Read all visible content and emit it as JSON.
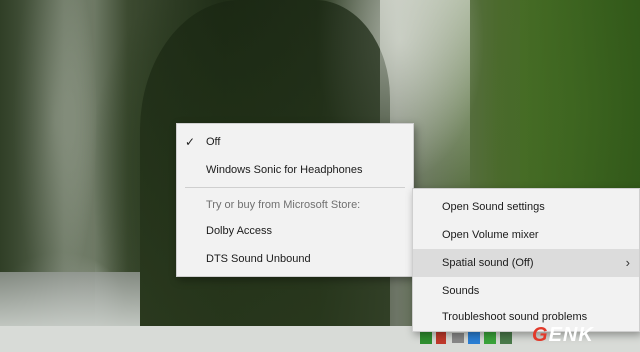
{
  "desktop": {
    "wallpaper": "mossy canyon"
  },
  "spatial_menu": {
    "items": [
      {
        "label": "Off",
        "checked": true
      },
      {
        "label": "Windows Sonic for Headphones"
      },
      {
        "label": "Try or buy from Microsoft Store:"
      },
      {
        "label": "Dolby Access"
      },
      {
        "label": "DTS Sound Unbound"
      }
    ]
  },
  "sound_menu": {
    "items": [
      {
        "label": "Open Sound settings"
      },
      {
        "label": "Open Volume mixer"
      },
      {
        "label": "Spatial sound (Off)"
      },
      {
        "label": "Sounds"
      },
      {
        "label": "Troubleshoot sound problems"
      }
    ],
    "chevron": "chevron-right-icon"
  },
  "watermark": {
    "prefix": "G",
    "rest": "ENK"
  },
  "colors": {
    "accent": "#e23a2b",
    "menu_bg": "#f2f2f2",
    "highlight": "#dcdcdc"
  }
}
